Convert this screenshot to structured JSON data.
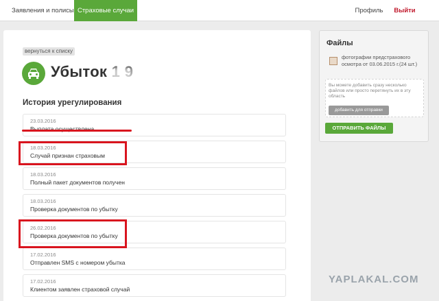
{
  "nav": {
    "apps": "Заявления и полисы",
    "cases": "Страховые случаи",
    "profile": "Профиль",
    "logout": "Выйти"
  },
  "main": {
    "back": "вернуться к списку",
    "title": "Убыток 1    9",
    "section": "История урегулирования",
    "history": [
      {
        "date": "23.03.2016",
        "text": "Выплата осуществлена"
      },
      {
        "date": "18.03.2016",
        "text": "Случай признан страховым"
      },
      {
        "date": "18.03.2016",
        "text": "Полный пакет документов получен"
      },
      {
        "date": "18.03.2016",
        "text": "Проверка документов по убытку"
      },
      {
        "date": "26.02.2016",
        "text": "Проверка документов по убытку"
      },
      {
        "date": "17.02.2016",
        "text": "Отправлен SMS с номером убытка"
      },
      {
        "date": "17.02.2016",
        "text": "Клиентом заявлен страховой случай"
      }
    ]
  },
  "files": {
    "title": "Файлы",
    "file_name": "фотографии предстрахового осмотра от 03.06.2015 г.(24 шт.)",
    "hint": "Вы можете добавить сразу несколько файлов или просто перетянуть их в эту область",
    "add": "добавить для отправки",
    "send": "ОТПРАВИТЬ ФАЙЛЫ"
  },
  "watermark": "YAPLAKAL.COM",
  "colors": {
    "accent": "#5aa83a",
    "alert": "#d9141e",
    "logout": "#c0182b"
  }
}
